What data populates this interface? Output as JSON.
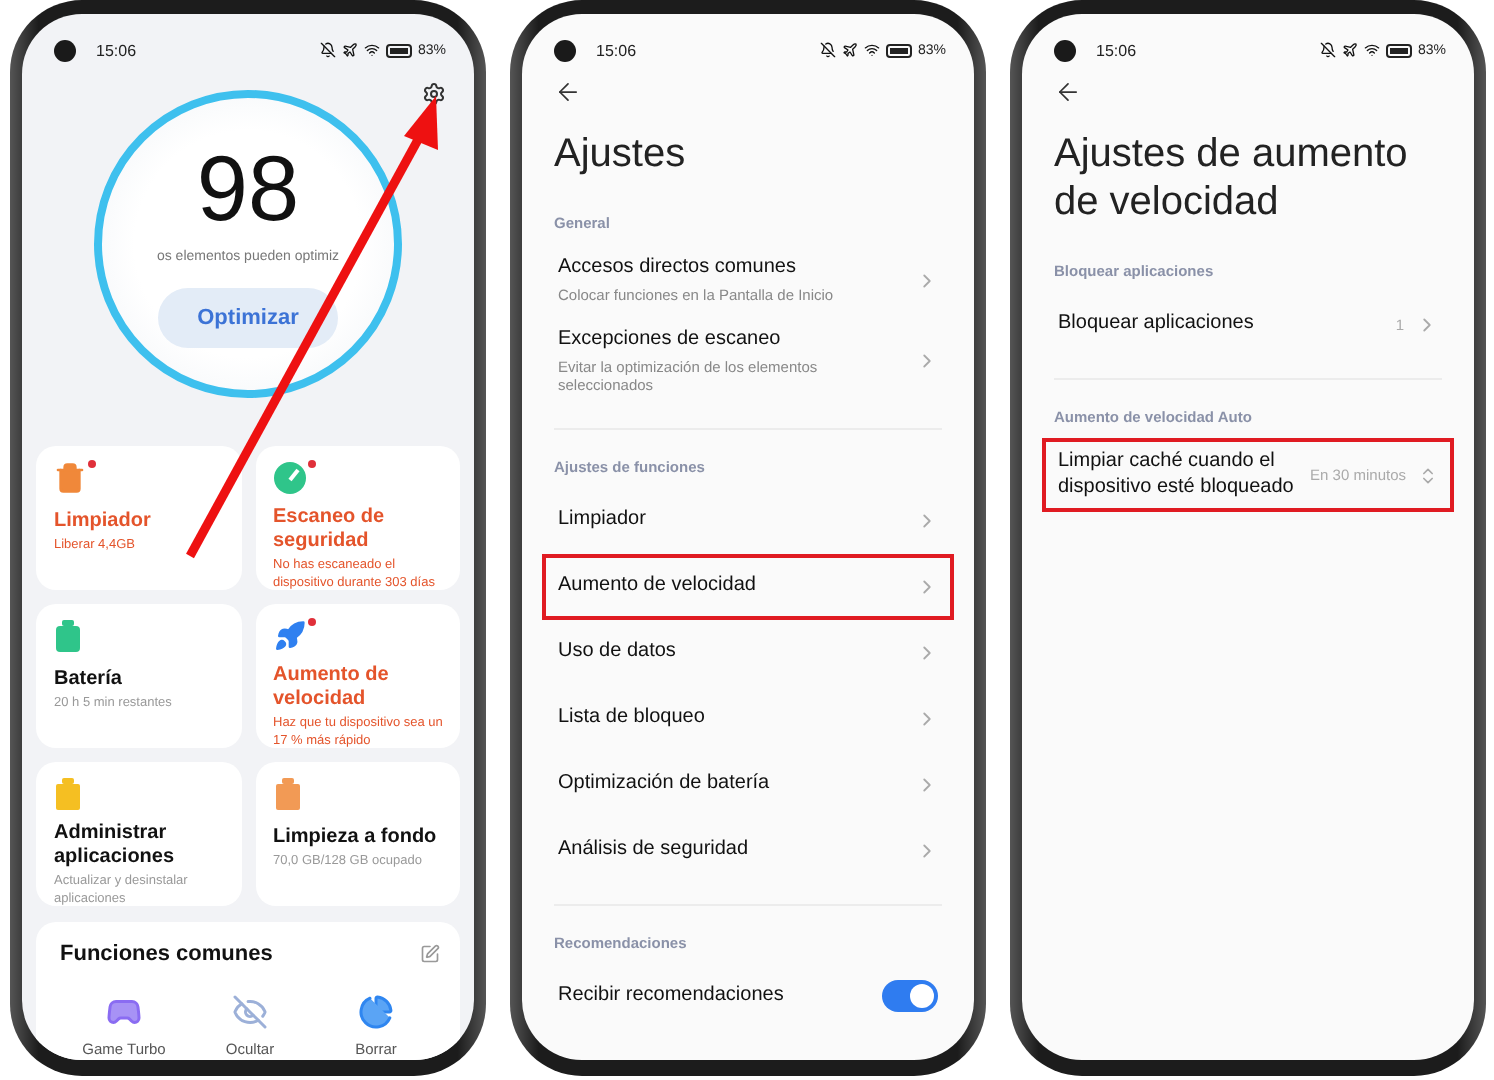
{
  "home_screen": {
    "status_bar": {
      "time": "15:06",
      "battery": "83%"
    },
    "score": "98",
    "score_caption": "os elementos pueden optimiz",
    "optimize_button": "Optimizar",
    "cards": [
      {
        "title": "Limpiador",
        "subtitle": "Liberar 4,4GB",
        "alert": true,
        "badge": true
      },
      {
        "title": "Escaneo de seguridad",
        "subtitle": "No has escaneado el dispositivo durante 303 días",
        "alert": true,
        "badge": true
      },
      {
        "title": "Batería",
        "subtitle": "20 h 5 min  restantes",
        "alert": false,
        "badge": false
      },
      {
        "title": "Aumento de velocidad",
        "subtitle": "Haz que tu dispositivo sea un 17 % más rápido",
        "alert": true,
        "badge": true
      },
      {
        "title": "Administrar aplicaciones",
        "subtitle": "Actualizar y desinstalar aplicaciones",
        "alert": false,
        "badge": false
      },
      {
        "title": "Limpieza a fondo",
        "subtitle": "70,0 GB/128 GB ocupado",
        "alert": false,
        "badge": false
      }
    ],
    "common_functions": {
      "title": "Funciones comunes",
      "shortcuts": [
        "Game Turbo",
        "Ocultar",
        "Borrar"
      ]
    }
  },
  "settings_screen": {
    "status_bar": {
      "time": "15:06",
      "battery": "83%"
    },
    "title": "Ajustes",
    "sections": [
      {
        "heading": "General",
        "items": [
          {
            "kind": "link",
            "label": "Accesos directos comunes",
            "description": "Colocar funciones en la Pantalla de Inicio",
            "highlighted": false
          },
          {
            "kind": "link",
            "label": "Excepciones de escaneo",
            "description": "Evitar la optimización de los elementos seleccionados",
            "highlighted": false
          }
        ]
      },
      {
        "heading": "Ajustes de funciones",
        "items": [
          {
            "kind": "link",
            "label": "Limpiador",
            "highlighted": false
          },
          {
            "kind": "link",
            "label": "Aumento de velocidad",
            "highlighted": true
          },
          {
            "kind": "link",
            "label": "Uso de datos",
            "highlighted": false
          },
          {
            "kind": "link",
            "label": "Lista de bloqueo",
            "highlighted": false
          },
          {
            "kind": "link",
            "label": "Optimización de batería",
            "highlighted": false
          },
          {
            "kind": "link",
            "label": "Análisis de seguridad",
            "highlighted": false
          }
        ]
      },
      {
        "heading": "Recomendaciones",
        "items": [
          {
            "kind": "toggle",
            "label": "Recibir recomendaciones",
            "on": true,
            "highlighted": false
          }
        ]
      }
    ]
  },
  "speed_settings_screen": {
    "status_bar": {
      "time": "15:06",
      "battery": "83%"
    },
    "title": "Ajustes de aumento de velocidad",
    "sections": [
      {
        "heading": "Bloquear aplicaciones",
        "items": [
          {
            "kind": "link",
            "label": "Bloquear aplicaciones",
            "value": "1",
            "highlighted": false
          }
        ]
      },
      {
        "heading": "Aumento de velocidad Auto",
        "items": [
          {
            "kind": "select",
            "label": "Limpiar caché cuando el dispositivo esté bloqueado",
            "value": "En 30 minutos",
            "highlighted": true
          }
        ]
      }
    ]
  }
}
